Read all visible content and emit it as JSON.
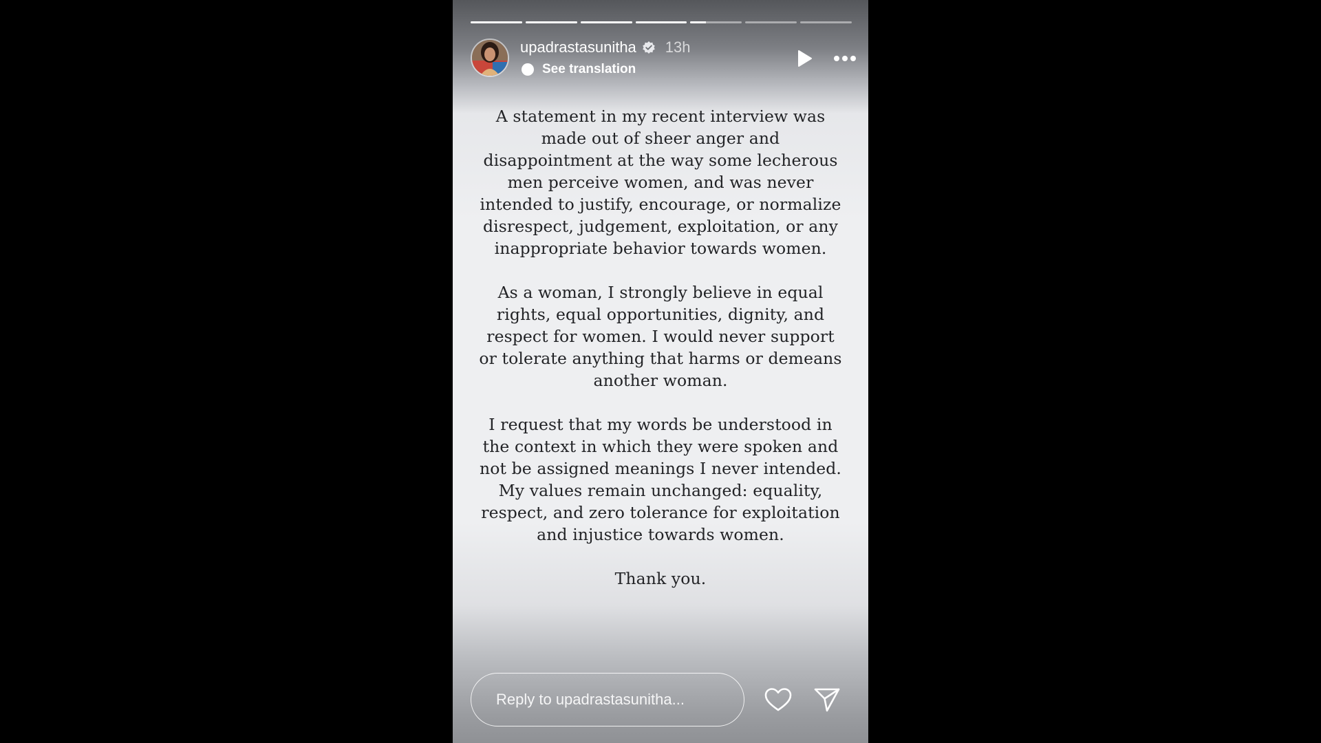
{
  "progress": {
    "segments": [
      1,
      1,
      1,
      1,
      0.3,
      0,
      0
    ]
  },
  "header": {
    "username": "upadrastasunitha",
    "time": "13h",
    "see_translation": "See translation",
    "play_icon": "play-icon",
    "more_icon": "more-options-icon",
    "verified_icon": "verified-badge-icon"
  },
  "statement": {
    "paragraphs": [
      "A statement in my recent interview was made out of sheer anger and disappointment at the way some lecherous men perceive women, and was never intended to justify, encourage, or normalize disrespect, judgement, exploitation, or any inappropriate behavior towards women.",
      "As a woman, I strongly believe in equal rights, equal opportunities, dignity, and respect for women. I would never support or tolerate anything that harms or demeans another woman.",
      "I request that my words be understood in the context in which they were spoken and not be assigned meanings I never intended. My values remain unchanged: equality, respect, and zero tolerance for exploitation and injustice towards women.",
      "Thank you."
    ]
  },
  "footer": {
    "reply_placeholder": "Reply to upadrastasunitha...",
    "like_icon": "heart-icon",
    "share_icon": "send-icon"
  },
  "colors": {
    "page_background": "#000000",
    "text": "#222326",
    "ui_foreground": "#ffffff"
  }
}
